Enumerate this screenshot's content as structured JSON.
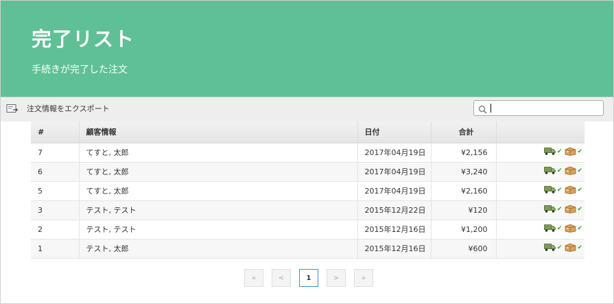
{
  "header": {
    "title": "完了リスト",
    "subtitle": "手続きが完了した注文",
    "background": "#5fc095"
  },
  "toolbar": {
    "export_label": "注文情報をエクスポート",
    "export_icon": "export-icon",
    "search_icon": "search-icon",
    "search_value": ""
  },
  "table": {
    "columns": [
      "#",
      "顧客情報",
      "日付",
      "合計",
      ""
    ],
    "rows": [
      {
        "id": "7",
        "customer": "てすと, 太郎",
        "date": "2017年04月19日",
        "total": "¥2,156"
      },
      {
        "id": "6",
        "customer": "てすと, 太郎",
        "date": "2017年04月19日",
        "total": "¥3,240"
      },
      {
        "id": "5",
        "customer": "てすと, 太郎",
        "date": "2017年04月19日",
        "total": "¥2,160"
      },
      {
        "id": "3",
        "customer": "テスト, テスト",
        "date": "2015年12月22日",
        "total": "¥120"
      },
      {
        "id": "2",
        "customer": "テスト, テスト",
        "date": "2015年12月16日",
        "total": "¥1,200"
      },
      {
        "id": "1",
        "customer": "テスト, 太郎",
        "date": "2015年12月16日",
        "total": "¥600"
      }
    ],
    "status_icons": [
      "truck-icon",
      "check-icon",
      "package-icon",
      "check-icon"
    ]
  },
  "pagination": {
    "first": "«",
    "prev": "<",
    "current": "1",
    "next": ">",
    "last": "»"
  }
}
